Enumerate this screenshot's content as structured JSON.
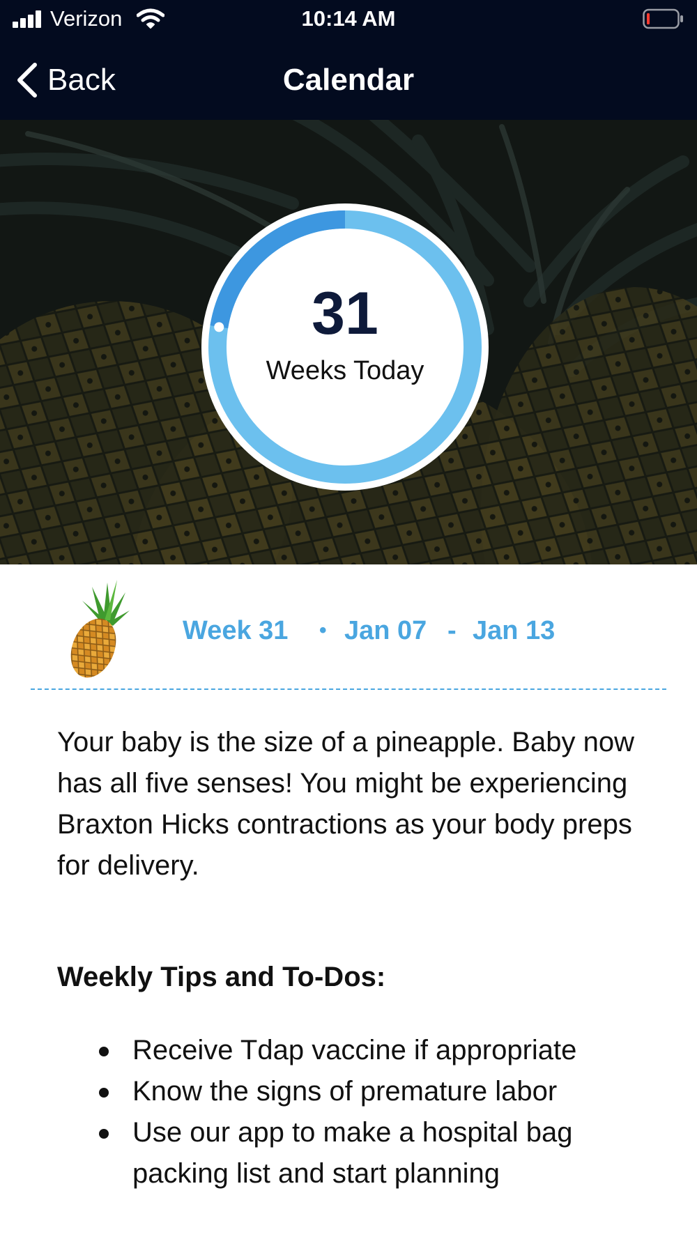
{
  "status_bar": {
    "carrier": "Verizon",
    "time": "10:14 AM",
    "icons": [
      "signal-icon",
      "wifi-icon",
      "battery-icon"
    ]
  },
  "nav": {
    "back_label": "Back",
    "title": "Calendar"
  },
  "hero": {
    "week_number": "31",
    "caption": "Weeks Today",
    "progress_fraction": 0.775,
    "colors": {
      "ring_track": "#6cc0ee",
      "ring_progress": "#3d97e0"
    }
  },
  "week": {
    "label": "Week 31",
    "separator": "•",
    "start": "Jan 07",
    "dash": "-",
    "end": "Jan 13",
    "accent": "#4aa6e0"
  },
  "description": "Your baby is the size of a pineapple. Baby now has all five senses! You might be experiencing Braxton Hicks contractions as your body preps for delivery.",
  "tips": {
    "heading": "Weekly Tips and To-Dos:",
    "items": [
      "Receive Tdap vaccine if appropriate",
      "Know the signs of premature labor",
      "Use our app to make a hospital bag packing list and start planning"
    ]
  }
}
